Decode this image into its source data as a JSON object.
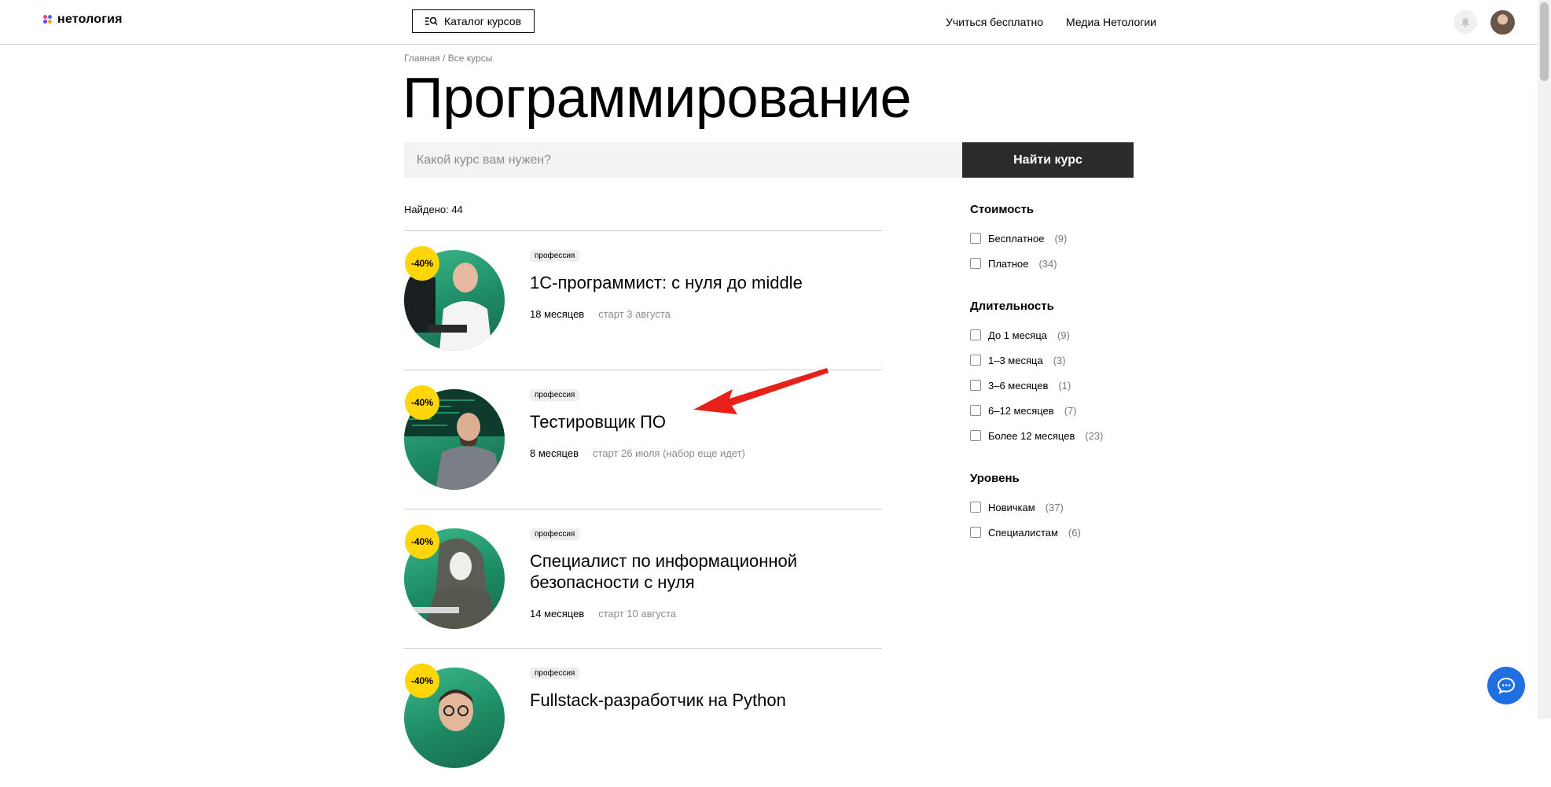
{
  "header": {
    "logo_text": "нетология",
    "catalog_label": "Каталог курсов",
    "nav_links": [
      "Учиться бесплатно",
      "Медиа Нетологии"
    ]
  },
  "breadcrumb": {
    "home": "Главная",
    "separator": "/",
    "current": "Все курсы"
  },
  "page": {
    "title": "Программирование"
  },
  "search": {
    "placeholder": "Какой курс вам нужен?",
    "button_label": "Найти курс"
  },
  "results": {
    "found_label": "Найдено: 44"
  },
  "courses": [
    {
      "discount": "-40%",
      "badge": "профессия",
      "title": "1С-программист: с нуля до middle",
      "duration": "18 месяцев",
      "start": "старт 3 августа"
    },
    {
      "discount": "-40%",
      "badge": "профессия",
      "title": "Тестировщик ПО",
      "duration": "8 месяцев",
      "start": "старт 26 июля (набор еще идет)"
    },
    {
      "discount": "-40%",
      "badge": "профессия",
      "title": "Специалист по информационной безопасности с нуля",
      "duration": "14 месяцев",
      "start": "старт 10 августа"
    },
    {
      "discount": "-40%",
      "badge": "профессия",
      "title": "Fullstack-разработчик на Python",
      "duration": "",
      "start": ""
    }
  ],
  "filters": [
    {
      "title": "Стоимость",
      "items": [
        {
          "label": "Бесплатное",
          "count": "(9)"
        },
        {
          "label": "Платное",
          "count": "(34)"
        }
      ]
    },
    {
      "title": "Длительность",
      "items": [
        {
          "label": "До 1 месяца",
          "count": "(9)"
        },
        {
          "label": "1–3 месяца",
          "count": "(3)"
        },
        {
          "label": "3–6 месяцев",
          "count": "(1)"
        },
        {
          "label": "6–12 месяцев",
          "count": "(7)"
        },
        {
          "label": "Более 12 месяцев",
          "count": "(23)"
        }
      ]
    },
    {
      "title": "Уровень",
      "items": [
        {
          "label": "Новичкам",
          "count": "(37)"
        },
        {
          "label": "Специалистам",
          "count": "(6)"
        }
      ]
    }
  ],
  "colors": {
    "accent_dark": "#2b2b2b",
    "discount_yellow": "#ffd60a",
    "chat_blue": "#1f6fe0",
    "arrow_red": "#e8201a"
  },
  "icons": {
    "catalog": "search-list-icon",
    "notifications": "bell-icon",
    "chat": "chat-bubble-icon"
  }
}
